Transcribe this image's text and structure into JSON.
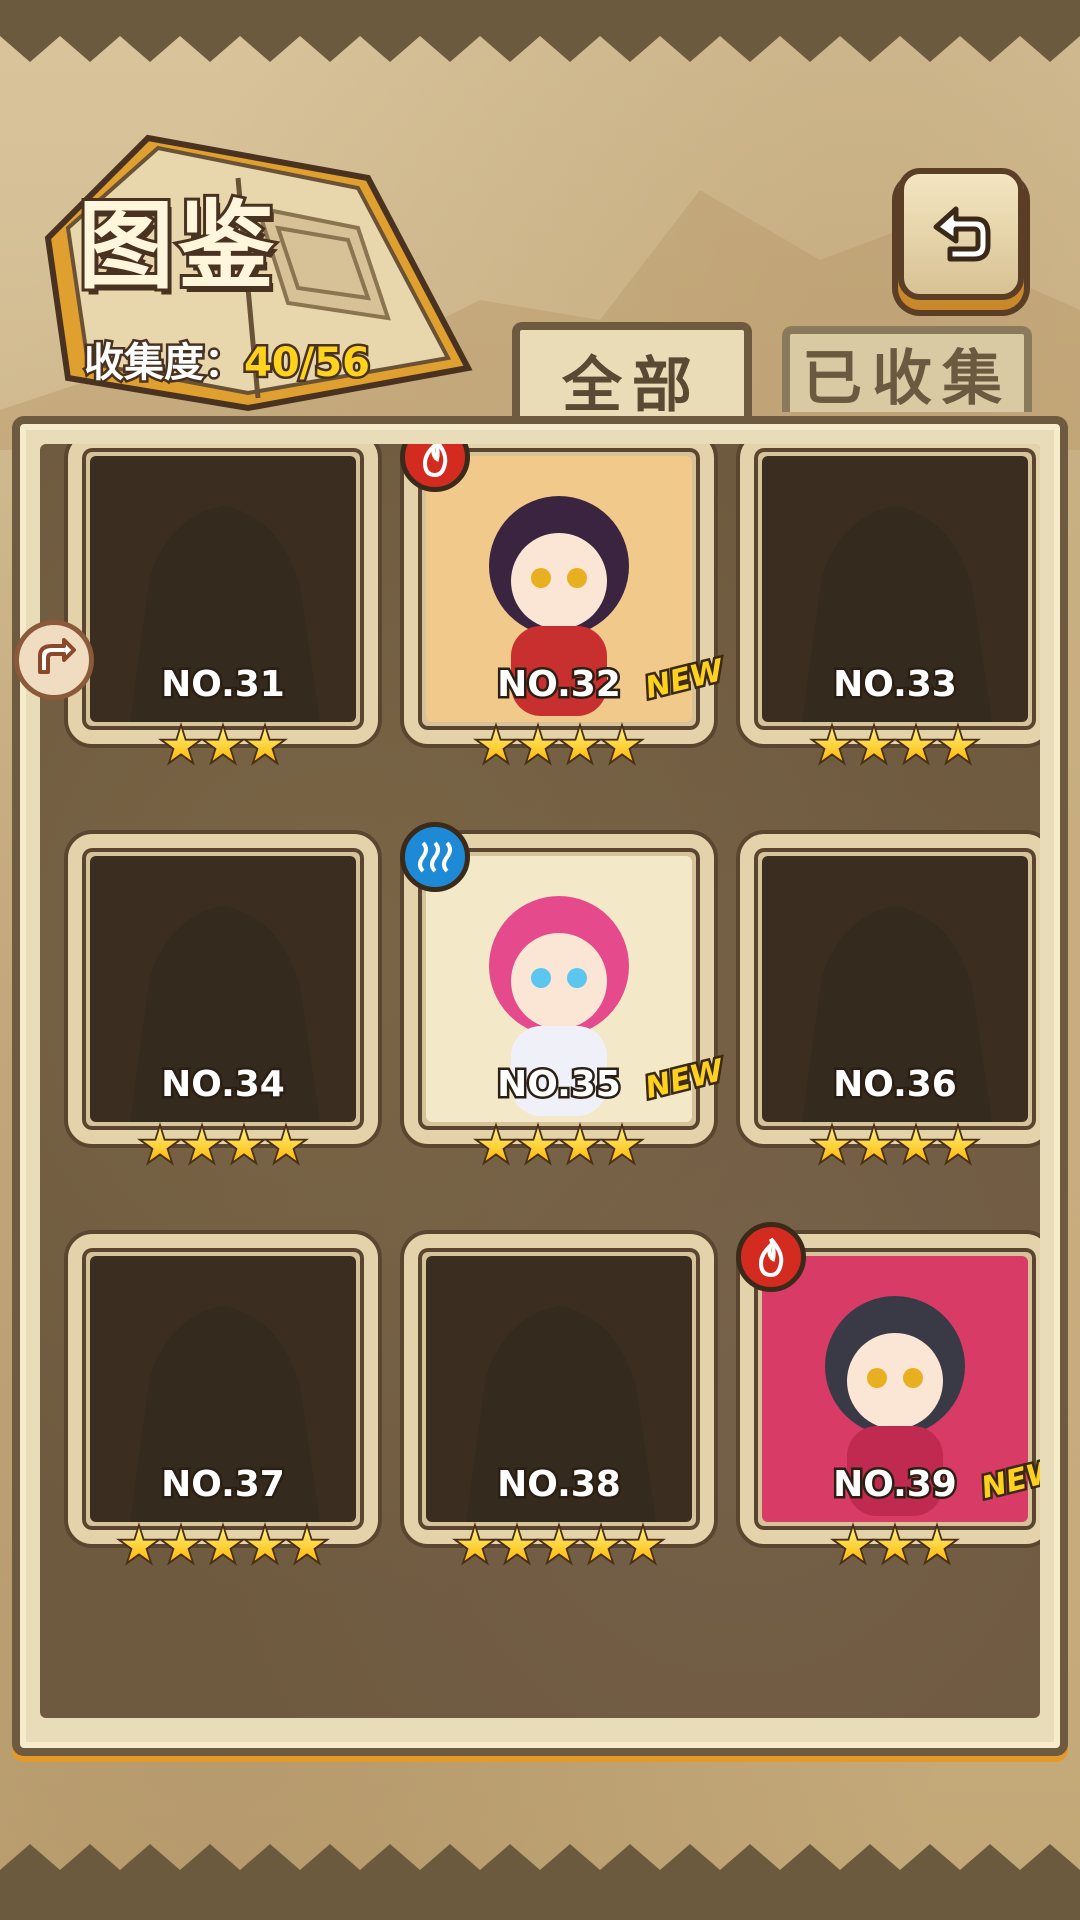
{
  "header": {
    "title": "图鉴",
    "progress_label": "收集度：",
    "progress_value": "40/56"
  },
  "tabs": [
    {
      "label": "全部",
      "selected": true
    },
    {
      "label": "已收集",
      "selected": false
    }
  ],
  "cards": [
    {
      "no": "NO.31",
      "stars": 3,
      "unlocked": false,
      "new": false,
      "element": ""
    },
    {
      "no": "NO.32",
      "stars": 4,
      "unlocked": true,
      "new": true,
      "new_label": "NEW",
      "element": "fire"
    },
    {
      "no": "NO.33",
      "stars": 4,
      "unlocked": false,
      "new": false,
      "element": ""
    },
    {
      "no": "NO.34",
      "stars": 4,
      "unlocked": false,
      "new": false,
      "element": ""
    },
    {
      "no": "NO.35",
      "stars": 4,
      "unlocked": true,
      "new": true,
      "new_label": "NEW",
      "element": "water"
    },
    {
      "no": "NO.36",
      "stars": 4,
      "unlocked": false,
      "new": false,
      "element": ""
    },
    {
      "no": "NO.37",
      "stars": 5,
      "unlocked": false,
      "new": false,
      "element": ""
    },
    {
      "no": "NO.38",
      "stars": 5,
      "unlocked": false,
      "new": false,
      "element": ""
    },
    {
      "no": "NO.39",
      "stars": 3,
      "unlocked": true,
      "new": true,
      "new_label": "NEW",
      "element": "fire"
    }
  ],
  "colors": {
    "star": "#ffc81a",
    "progress_value": "#ffd21e",
    "fire_badge": "#d32b20",
    "water_badge": "#1e8ad6",
    "new_badge": "#ffd11e"
  },
  "icons": [
    "back-arrow-icon",
    "book-icon",
    "fire-element-icon",
    "water-element-icon",
    "side-arrow-icon",
    "star-icon"
  ]
}
